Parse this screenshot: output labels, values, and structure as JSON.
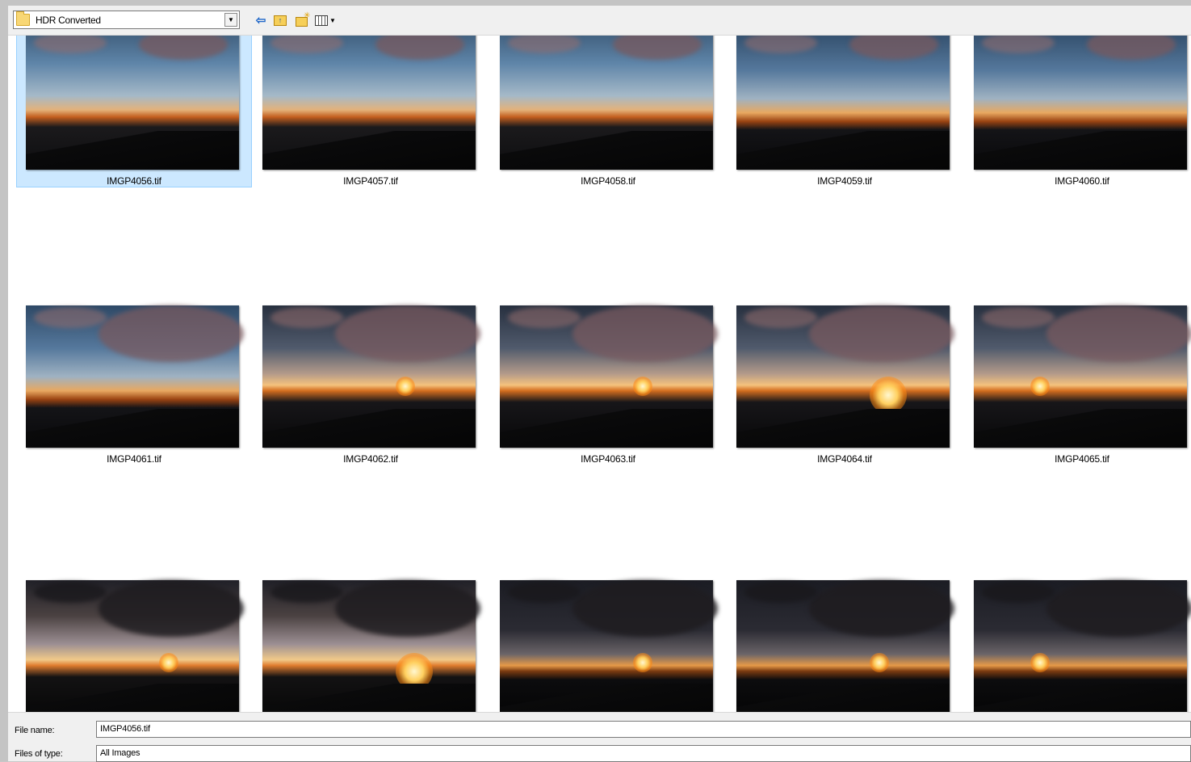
{
  "toolbar": {
    "look_in_value": "HDR Converted",
    "icons": [
      "folder-icon",
      "back-arrow-icon",
      "up-folder-icon",
      "new-folder-icon",
      "view-menu-icon"
    ]
  },
  "files": [
    {
      "name": "IMGP4056.tif",
      "selected": true
    },
    {
      "name": "IMGP4057.tif"
    },
    {
      "name": "IMGP4058.tif"
    },
    {
      "name": "IMGP4059.tif"
    },
    {
      "name": "IMGP4060.tif"
    },
    {
      "name": "IMGP4061.tif"
    },
    {
      "name": "IMGP4062.tif"
    },
    {
      "name": "IMGP4063.tif"
    },
    {
      "name": "IMGP4064.tif"
    },
    {
      "name": "IMGP4065.tif"
    },
    {
      "name": ""
    },
    {
      "name": ""
    },
    {
      "name": ""
    },
    {
      "name": ""
    },
    {
      "name": ""
    }
  ],
  "bottom": {
    "file_name_label": "File name:",
    "file_name_value": "IMGP4056.tif",
    "file_type_label": "Files of type:",
    "file_type_value": "All Images"
  },
  "colors": {
    "selection_bg": "#cce8ff",
    "selection_border": "#99d1ff"
  }
}
